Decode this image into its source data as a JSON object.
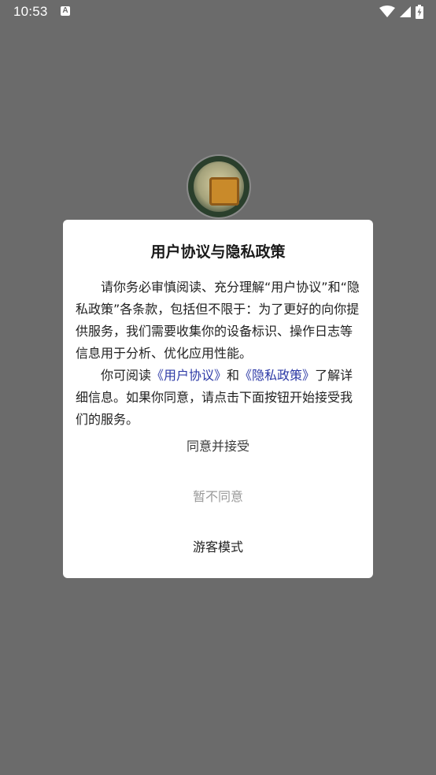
{
  "status_bar": {
    "time": "10:53",
    "notification_icon_letter": "A"
  },
  "dialog": {
    "title": "用户协议与隐私政策",
    "paragraph1": "请你务必审慎阅读、充分理解“用户协议”和“隐私政策”各条款，包括但不限于：为了更好的向你提供服务，我们需要收集你的设备标识、操作日志等信息用于分析、优化应用性能。",
    "paragraph2_prefix": "你可阅读",
    "user_agreement_link": "《用户协议》",
    "paragraph2_and": "和",
    "privacy_policy_link": "《隐私政策》",
    "paragraph2_suffix": "了解详细信息。如果你同意，请点击下面按钮开始接受我们的服务。",
    "agree_button": "同意并接受",
    "disagree_button": "暂不同意",
    "guest_button": "游客模式"
  },
  "colors": {
    "overlay_background": "#6b6b6b",
    "link": "#2d3aa6",
    "disagree_text": "#9a9a9a"
  }
}
